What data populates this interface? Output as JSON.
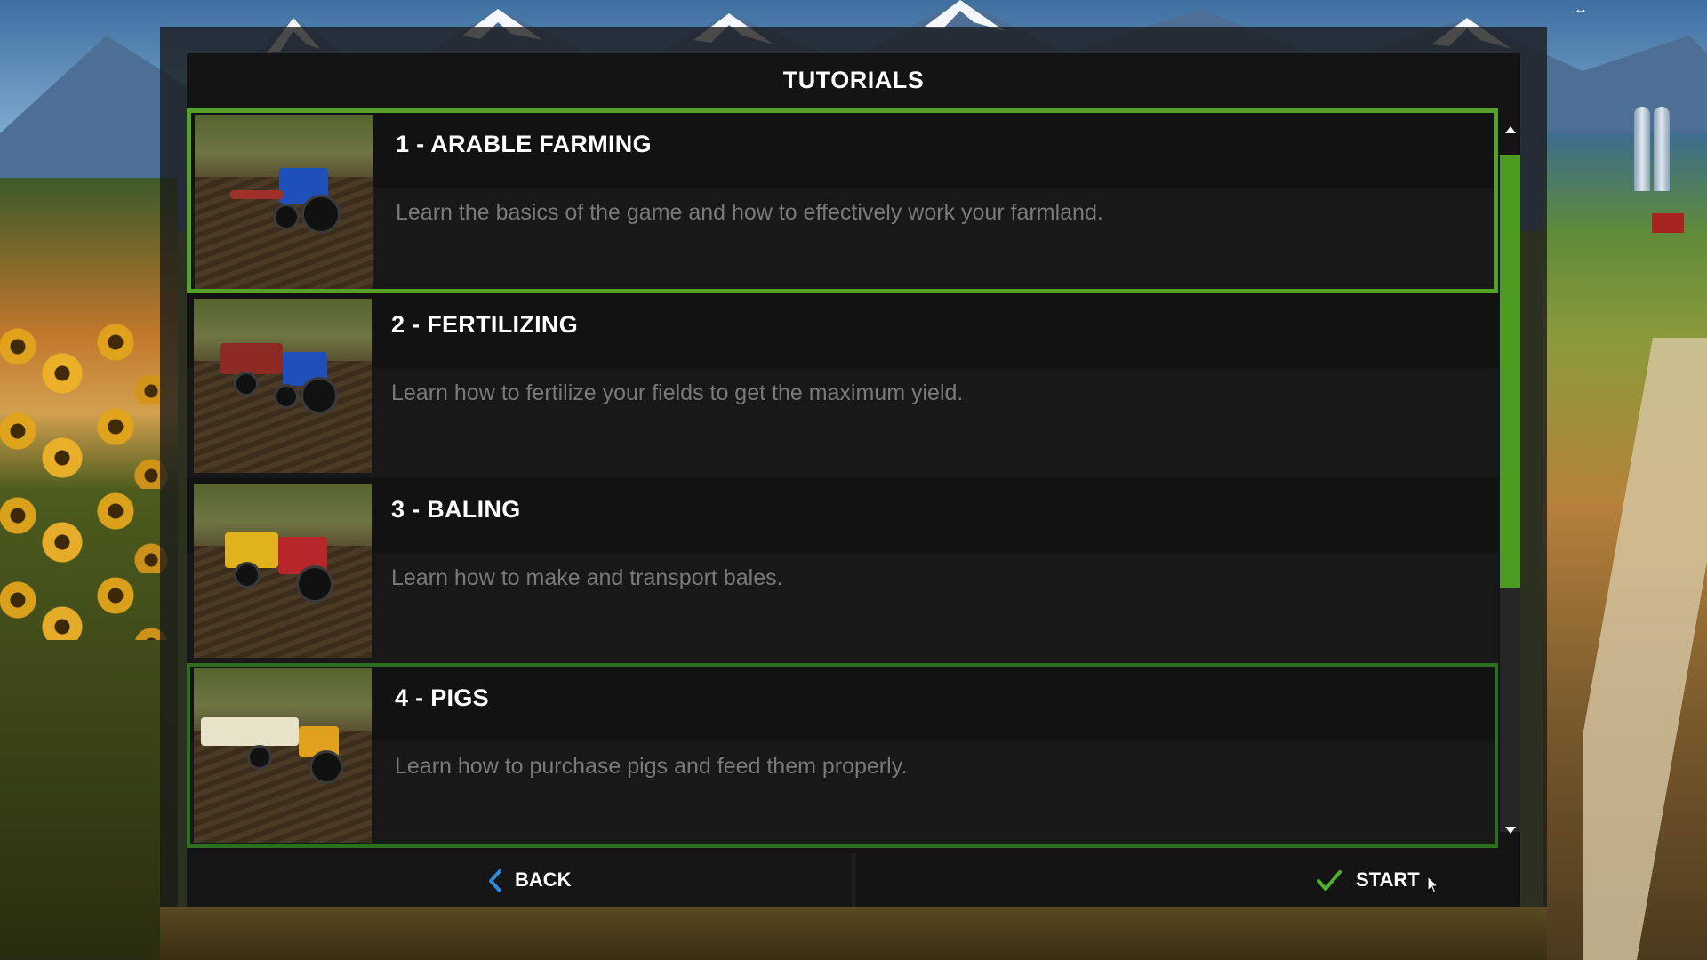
{
  "dialog": {
    "title": "TUTORIALS"
  },
  "tutorials": [
    {
      "title": "1 - ARABLE FARMING",
      "description": "Learn the basics of the game and how to effectively work your farmland.",
      "state": "selected",
      "thumbnail_icon": "tractor-with-plow-thumbnail"
    },
    {
      "title": "2 - FERTILIZING",
      "description": "Learn how to fertilize your fields to get the maximum yield.",
      "state": "normal",
      "thumbnail_icon": "tractor-with-spreader-thumbnail"
    },
    {
      "title": "3 - BALING",
      "description": "Learn how to make and transport bales.",
      "state": "normal",
      "thumbnail_icon": "tractor-with-baler-thumbnail"
    },
    {
      "title": "4 - PIGS",
      "description": "Learn how to purchase pigs and feed them properly.",
      "state": "hover",
      "thumbnail_icon": "tractor-with-trailer-thumbnail"
    }
  ],
  "footer": {
    "back_label": "BACK",
    "start_label": "START"
  },
  "colors": {
    "accent_green": "#55a12a",
    "back_icon_blue": "#2f8bd8",
    "start_icon_green": "#4fb02a"
  }
}
